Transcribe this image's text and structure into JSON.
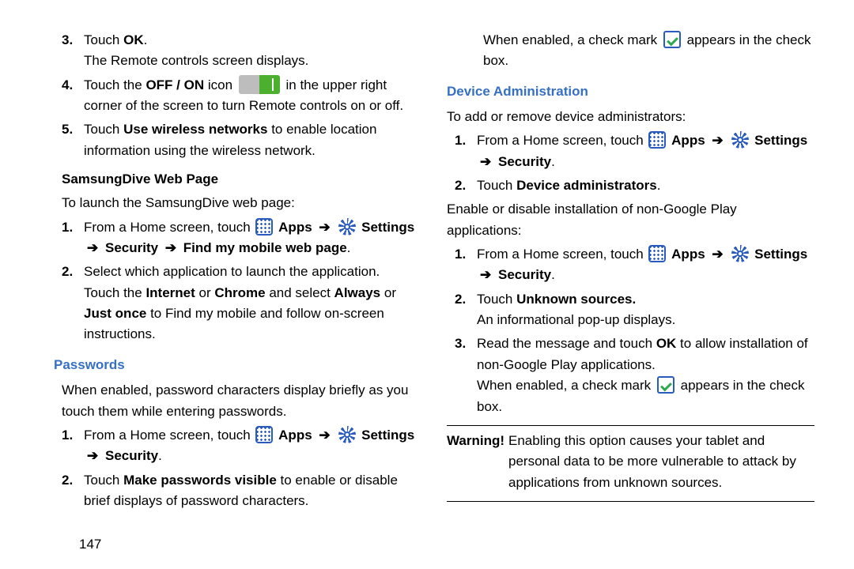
{
  "left": {
    "step3": {
      "num": "3.",
      "line1_a": "Touch ",
      "line1_b": "OK",
      "line1_c": ".",
      "line2": "The Remote controls screen displays."
    },
    "step4": {
      "num": "4.",
      "line_a": "Touch the ",
      "line_b": "OFF / ON",
      "line_c": " icon ",
      "line_d": " in the upper right corner of the screen to turn Remote controls on or off."
    },
    "step5": {
      "num": "5.",
      "line_a": "Touch ",
      "line_b": "Use wireless networks",
      "line_c": " to enable location information using the wireless network."
    },
    "sub1_heading": "SamsungDive Web Page",
    "sub1_intro": "To launch the SamsungDive web page:",
    "sub1_step1": {
      "num": "1.",
      "pre": "From a Home screen, touch ",
      "apps": "Apps",
      "settings": "Settings",
      "post1": "Security",
      "post2": "Find my mobile web page",
      "period": "."
    },
    "sub1_step2": {
      "num": "2.",
      "a": "Select which application to launch the application. Touch the ",
      "b": "Internet",
      "c": " or ",
      "d": "Chrome",
      "e": "  and select ",
      "f": "Always",
      "g": " or ",
      "h": "Just once",
      "i": " to Find my mobile and follow on-screen instructions."
    },
    "passwords_heading": "Passwords",
    "passwords_intro": "When enabled, password characters display briefly as you touch them while entering passwords.",
    "pw_step1": {
      "num": "1.",
      "pre": "From a Home screen, touch ",
      "apps": "Apps",
      "settings": "Settings",
      "post1": "Security",
      "period": "."
    },
    "pw_step2": {
      "num": "2.",
      "a": "Touch ",
      "b": "Make passwords visible",
      "c": " to enable or disable brief displays of password characters."
    }
  },
  "right": {
    "cont": {
      "a": "When enabled, a check mark ",
      "b": " appears in the check box."
    },
    "devadmin_heading": "Device Administration",
    "devadmin_intro": "To add or remove device administrators:",
    "da_step1": {
      "num": "1.",
      "pre": "From a Home screen, touch ",
      "apps": "Apps",
      "settings": "Settings",
      "post1": "Security",
      "period": "."
    },
    "da_step2": {
      "num": "2.",
      "a": "Touch ",
      "b": "Device administrators",
      "c": "."
    },
    "nonplay_intro": "Enable or disable installation of non-Google Play applications:",
    "np_step1": {
      "num": "1.",
      "pre": "From a Home screen, touch ",
      "apps": "Apps",
      "settings": "Settings",
      "post1": "Security",
      "period": "."
    },
    "np_step2": {
      "num": "2.",
      "a": "Touch ",
      "b": "Unknown sources.",
      "line2": "An informational pop-up displays."
    },
    "np_step3": {
      "num": "3.",
      "a": "Read the message and touch ",
      "b": "OK",
      "c": " to allow installation of non-Google Play applications.",
      "d": "When enabled, a check mark ",
      "e": " appears in the check box."
    },
    "warning_label": "Warning!",
    "warning_text": " Enabling this option causes your tablet and personal data to be more vulnerable to attack by applications from unknown sources."
  },
  "pagenum": "147",
  "arrow": "➔"
}
